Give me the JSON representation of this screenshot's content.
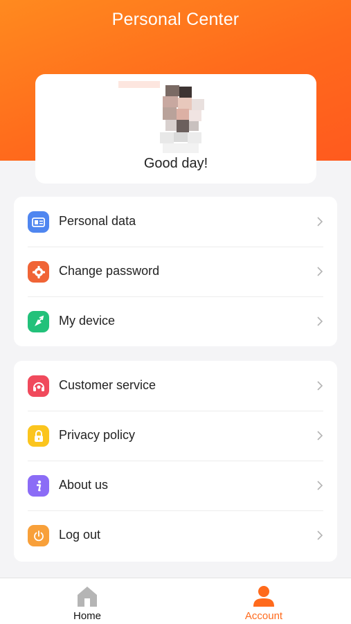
{
  "header": {
    "title": "Personal Center"
  },
  "profile": {
    "greeting": "Good day!"
  },
  "menu_group_1": [
    {
      "label": "Personal data",
      "icon": "id-card-icon",
      "color": "#4f86f0"
    },
    {
      "label": "Change password",
      "icon": "gear-icon",
      "color": "#f06436"
    },
    {
      "label": "My device",
      "icon": "device-icon",
      "color": "#22c17a"
    }
  ],
  "menu_group_2": [
    {
      "label": "Customer service",
      "icon": "headset-icon",
      "color": "#f04a5c"
    },
    {
      "label": "Privacy policy",
      "icon": "lock-icon",
      "color": "#fbc51e"
    },
    {
      "label": "About us",
      "icon": "info-icon",
      "color": "#8b6cf6"
    },
    {
      "label": "Log out",
      "icon": "power-icon",
      "color": "#f8a03a"
    }
  ],
  "tabbar": {
    "home_label": "Home",
    "account_label": "Account",
    "active": "Account"
  },
  "colors": {
    "accent": "#ff6a1c",
    "header_gradient_start": "#ff8a1f",
    "header_gradient_end": "#ff5a1e"
  }
}
